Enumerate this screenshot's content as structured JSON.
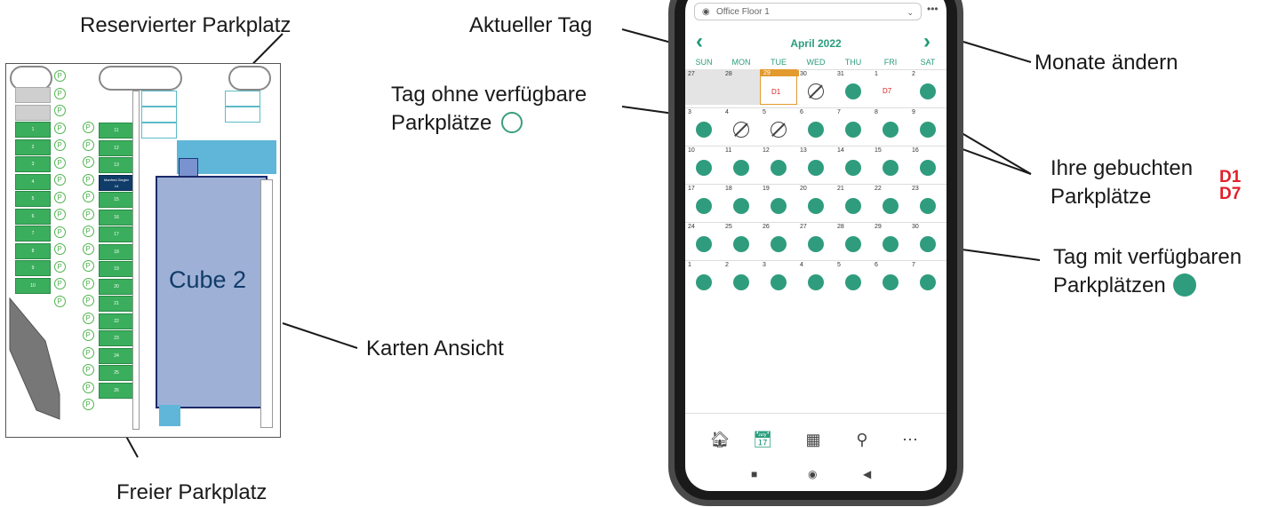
{
  "annotations": {
    "reserved": "Reservierter Parkplatz",
    "free": "Freier Parkplatz",
    "map_view": "Karten Ansicht",
    "current_day": "Aktueller Tag",
    "no_available_line1": "Tag ohne verfügbare",
    "no_available_line2": "Parkplätze",
    "change_months": "Monate ändern",
    "booked_line1": "Ihre gebuchten",
    "booked_line2": "Parkplätze",
    "booked_codes": [
      "D1",
      "D7"
    ],
    "available_line1": "Tag mit verfügbaren",
    "available_line2": "Parkplätzen"
  },
  "map": {
    "building_label": "Cube 2",
    "left_column": [
      "",
      "",
      "1",
      "2",
      "3",
      "4",
      "5",
      "6",
      "7",
      "8",
      "9",
      "10"
    ],
    "middle_column": [
      "11",
      "12",
      "13",
      "Manfred Ziegler",
      "15",
      "16",
      "17",
      "18",
      "19",
      "20",
      "21",
      "22",
      "23",
      "24",
      "25",
      "26"
    ],
    "reserved_slot_number": "14"
  },
  "app": {
    "location": "Office Floor 1",
    "month": "April 2022",
    "weekdays": [
      "SUN",
      "MON",
      "TUE",
      "WED",
      "THU",
      "FRI",
      "SAT"
    ],
    "weeks": [
      [
        {
          "d": "27",
          "s": "past"
        },
        {
          "d": "28",
          "s": "past"
        },
        {
          "d": "29",
          "s": "today",
          "b": "D1"
        },
        {
          "d": "30",
          "s": "none"
        },
        {
          "d": "31",
          "s": "avail"
        },
        {
          "d": "1",
          "s": "booked",
          "b": "D7"
        },
        {
          "d": "2",
          "s": "avail"
        }
      ],
      [
        {
          "d": "3",
          "s": "avail"
        },
        {
          "d": "4",
          "s": "none"
        },
        {
          "d": "5",
          "s": "none"
        },
        {
          "d": "6",
          "s": "avail"
        },
        {
          "d": "7",
          "s": "avail"
        },
        {
          "d": "8",
          "s": "avail"
        },
        {
          "d": "9",
          "s": "avail"
        }
      ],
      [
        {
          "d": "10",
          "s": "avail"
        },
        {
          "d": "11",
          "s": "avail"
        },
        {
          "d": "12",
          "s": "avail"
        },
        {
          "d": "13",
          "s": "avail"
        },
        {
          "d": "14",
          "s": "avail"
        },
        {
          "d": "15",
          "s": "avail"
        },
        {
          "d": "16",
          "s": "avail"
        }
      ],
      [
        {
          "d": "17",
          "s": "avail"
        },
        {
          "d": "18",
          "s": "avail"
        },
        {
          "d": "19",
          "s": "avail"
        },
        {
          "d": "20",
          "s": "avail"
        },
        {
          "d": "21",
          "s": "avail"
        },
        {
          "d": "22",
          "s": "avail"
        },
        {
          "d": "23",
          "s": "avail"
        }
      ],
      [
        {
          "d": "24",
          "s": "avail"
        },
        {
          "d": "25",
          "s": "avail"
        },
        {
          "d": "26",
          "s": "avail"
        },
        {
          "d": "27",
          "s": "avail"
        },
        {
          "d": "28",
          "s": "avail"
        },
        {
          "d": "29",
          "s": "avail"
        },
        {
          "d": "30",
          "s": "avail"
        }
      ],
      [
        {
          "d": "1",
          "s": "avail"
        },
        {
          "d": "2",
          "s": "avail"
        },
        {
          "d": "3",
          "s": "avail"
        },
        {
          "d": "4",
          "s": "avail"
        },
        {
          "d": "5",
          "s": "avail"
        },
        {
          "d": "6",
          "s": "avail"
        },
        {
          "d": "7",
          "s": "avail"
        }
      ]
    ],
    "tabs": [
      "home-icon",
      "calendar-icon",
      "qr-code-icon",
      "search-icon",
      "more-icon"
    ],
    "system_nav": [
      "recent-apps-icon",
      "home-button-icon",
      "back-icon"
    ]
  },
  "colors": {
    "available": "#2f9c7e",
    "today": "#e39a2f",
    "booked_code": "#d22222",
    "free_slot": "#3aae5c",
    "reserved_slot": "#0f3c68",
    "building": "#9fb0d6"
  }
}
